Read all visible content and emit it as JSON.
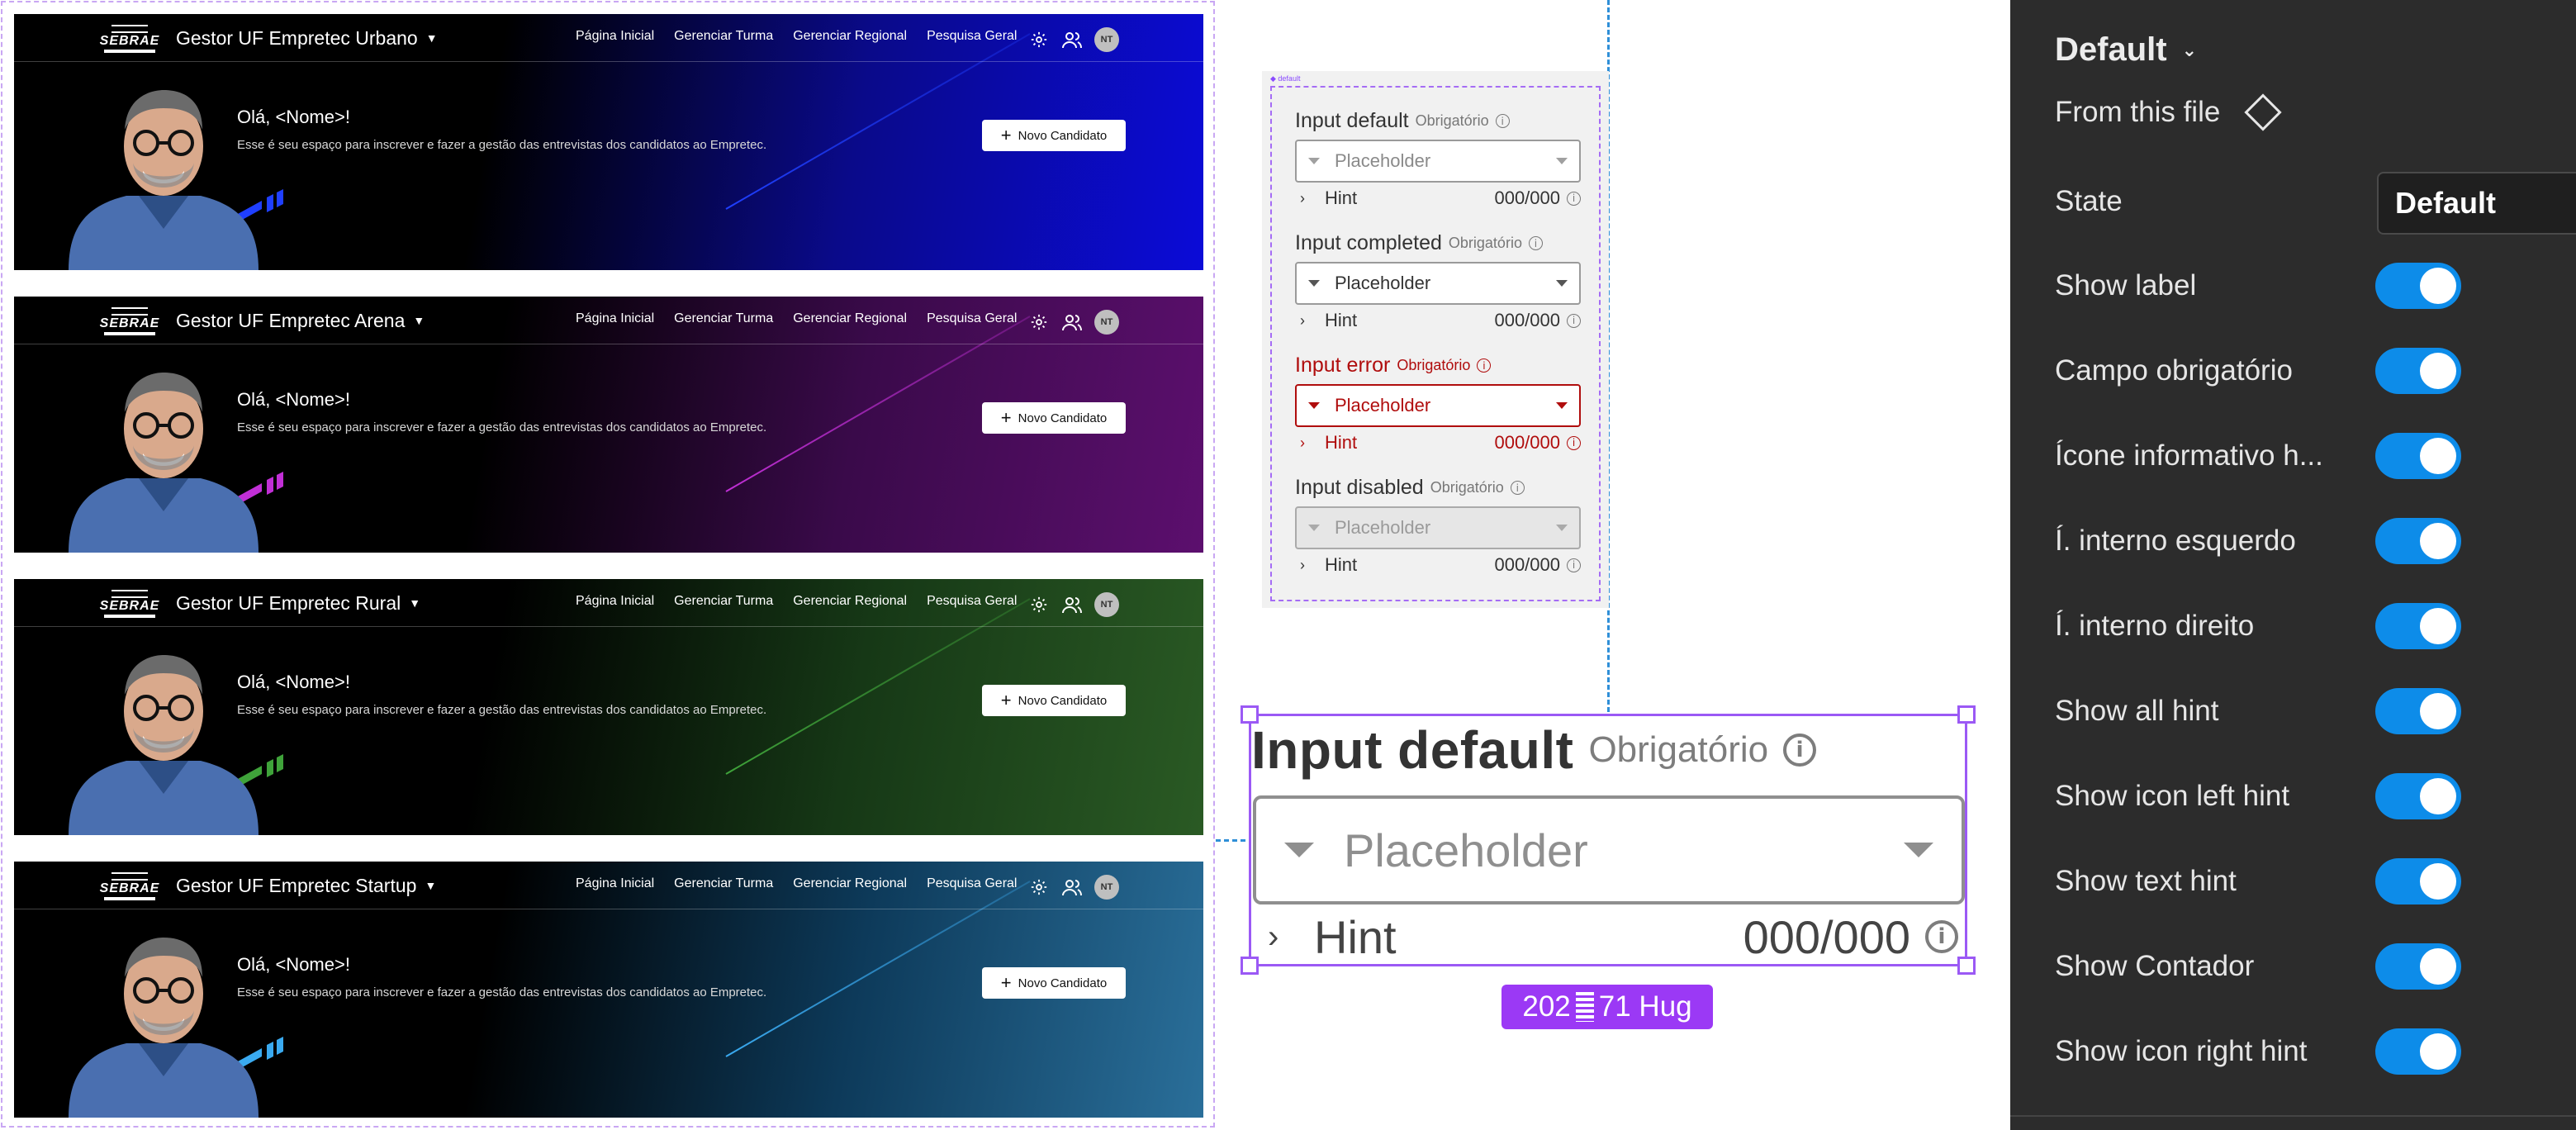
{
  "banners": [
    {
      "title": "Gestor UF Empretec Urbano",
      "theme": "urbano",
      "bg_gradient": [
        "#000000",
        "#0a0a8a",
        "#0b0bd8"
      ],
      "stripe_color": "#1f3fff"
    },
    {
      "title": "Gestor UF Empretec Arena",
      "theme": "arena",
      "bg_gradient": [
        "#000000",
        "#3a0a4a",
        "#5c0f6e"
      ],
      "stripe_color": "#c12fd6"
    },
    {
      "title": "Gestor UF Empretec Rural",
      "theme": "rural",
      "bg_gradient": [
        "#000000",
        "#163816",
        "#2a5a24"
      ],
      "stripe_color": "#3fa33a"
    },
    {
      "title": "Gestor UF Empretec Startup",
      "theme": "startup",
      "bg_gradient": [
        "#000000",
        "#0d3a5a",
        "#2a6f9a"
      ],
      "stripe_color": "#3aaaf0"
    }
  ],
  "banner_common": {
    "logo_text": "SEBRAE",
    "nav": [
      "Página Inicial",
      "Gerenciar Turma",
      "Gerenciar Regional",
      "Pesquisa Geral"
    ],
    "avatar_initials": "NT",
    "greeting": "Olá, <Nome>!",
    "subtitle": "Esse é seu espaço para inscrever e fazer a gestão das entrevistas dos candidatos ao Empretec.",
    "cta_label": "Novo Candidato",
    "icons": [
      "gear-icon",
      "users-icon"
    ]
  },
  "mini_frame": {
    "tag": "◆ default",
    "fields": [
      {
        "state": "default",
        "label": "Input default",
        "required": "Obrigatório",
        "placeholder": "Placeholder",
        "hint": "Hint",
        "counter": "000/000"
      },
      {
        "state": "completed",
        "label": "Input completed",
        "required": "Obrigatório",
        "placeholder": "Placeholder",
        "hint": "Hint",
        "counter": "000/000"
      },
      {
        "state": "error",
        "label": "Input error",
        "required": "Obrigatório",
        "placeholder": "Placeholder",
        "hint": "Hint",
        "counter": "000/000"
      },
      {
        "state": "disabled",
        "label": "Input disabled",
        "required": "Obrigatório",
        "placeholder": "Placeholder",
        "hint": "Hint",
        "counter": "000/000"
      }
    ]
  },
  "selected": {
    "label": "Input default",
    "required": "Obrigatório",
    "placeholder": "Placeholder",
    "hint": "Hint",
    "counter": "000/000",
    "size_pill": "202",
    "size_pill_rest": "71 Hug"
  },
  "panel": {
    "title": "Default",
    "from_file": "From this file",
    "state_label": "State",
    "state_value": "Default",
    "toggles": [
      {
        "label": "Show label",
        "on": true
      },
      {
        "label": "Campo obrigatório",
        "on": true
      },
      {
        "label": "Ícone informativo h...",
        "on": true
      },
      {
        "label": "Í. interno esquerdo",
        "on": true
      },
      {
        "label": "Í. interno direito",
        "on": true
      },
      {
        "label": "Show all hint",
        "on": true
      },
      {
        "label": "Show icon left hint",
        "on": true
      },
      {
        "label": "Show text hint",
        "on": true
      },
      {
        "label": "Show Contador",
        "on": true
      },
      {
        "label": "Show icon right hint",
        "on": true
      }
    ]
  },
  "colors": {
    "accent": "#9b59f5",
    "toggle_on": "#0d8ce9",
    "error": "#b00d0d",
    "guide": "#2f8fd8"
  }
}
